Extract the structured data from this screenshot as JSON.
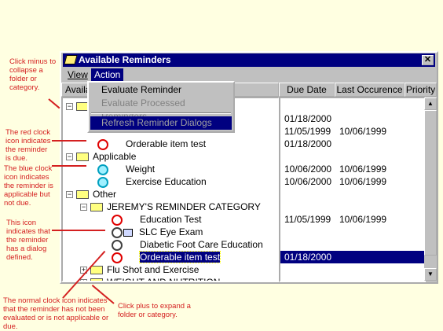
{
  "window": {
    "title": "Available Reminders",
    "close": "✕"
  },
  "menubar": {
    "view": "View",
    "action": "Action"
  },
  "action_menu": {
    "items": [
      "Evaluate Reminder",
      "Evaluate Processed Reminders",
      "Refresh Reminder Dialogs"
    ]
  },
  "columns": {
    "name": "Available Reminders",
    "due": "Due Date",
    "last": "Last Occurence",
    "priority": "Priority"
  },
  "rows": [
    {
      "label": "",
      "due": "",
      "last": ""
    },
    {
      "label": "",
      "due": "01/18/2000",
      "last": ""
    },
    {
      "label": "",
      "due": "11/05/1999",
      "last": "10/06/1999"
    },
    {
      "label": "Orderable item test",
      "due": "01/18/2000",
      "last": ""
    },
    {
      "label": "Applicable",
      "due": "",
      "last": ""
    },
    {
      "label": "Weight",
      "due": "10/06/2000",
      "last": "10/06/1999"
    },
    {
      "label": "Exercise Education",
      "due": "10/06/2000",
      "last": "10/06/1999"
    },
    {
      "label": "Other",
      "due": "",
      "last": ""
    },
    {
      "label": "JEREMY'S REMINDER CATEGORY",
      "due": "",
      "last": ""
    },
    {
      "label": "Education Test",
      "due": "11/05/1999",
      "last": "10/06/1999"
    },
    {
      "label": "SLC Eye Exam",
      "due": "",
      "last": ""
    },
    {
      "label": "Diabetic Foot Care Education",
      "due": "",
      "last": ""
    },
    {
      "label": "Orderable item test",
      "due": "01/18/2000",
      "last": ""
    },
    {
      "label": "Flu Shot and Exercise",
      "due": "",
      "last": ""
    },
    {
      "label": "WEIGHT AND NUTRITION",
      "due": "",
      "last": ""
    }
  ],
  "notes": {
    "minus": "Click minus to collapse a folder or category.",
    "red": "The red clock icon indicates the reminder is due.",
    "blue": "The blue clock icon indicates the reminder is applicable but not due.",
    "dialog": "This icon indicates that the reminder has a dialog defined.",
    "normal": "The normal clock icon indicates that the reminder has not been evaluated or is not applicable or due.",
    "plus": "Click plus to expand a folder or category."
  },
  "colors": {
    "red_clock": "#e00000",
    "blue_clock": "#00a0c0",
    "selection": "#000080",
    "annotation": "#d42020"
  }
}
